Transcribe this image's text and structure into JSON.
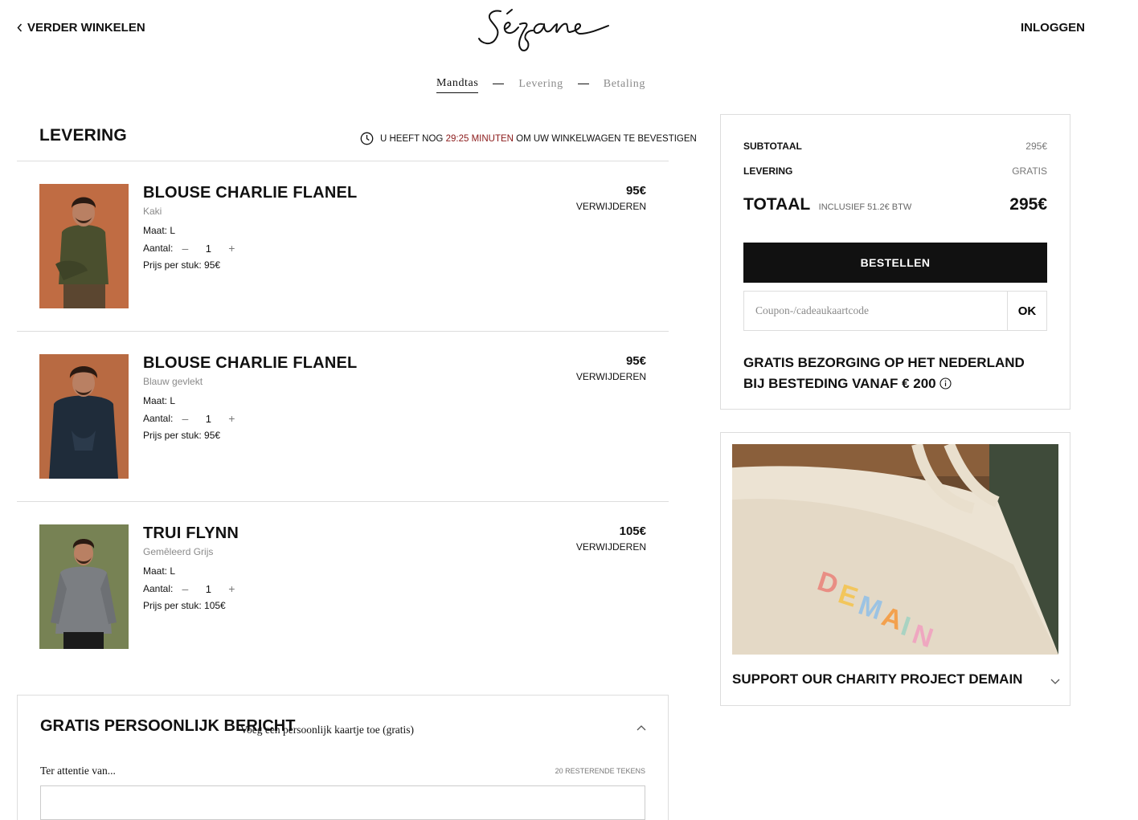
{
  "header": {
    "back_label": "VERDER WINKELEN",
    "logo_text": "Sézane",
    "login_label": "INLOGGEN"
  },
  "steps": [
    {
      "label": "Mandtas",
      "active": true
    },
    {
      "label": "Levering",
      "active": false
    },
    {
      "label": "Betaling",
      "active": false
    }
  ],
  "cart": {
    "title": "LEVERING",
    "timer_prefix": "U HEEFT NOG",
    "timer_time": "29:25 MINUTEN",
    "timer_suffix": "OM UW WINKELWAGEN TE BEVESTIGEN",
    "items": [
      {
        "name": "BLOUSE CHARLIE FLANEL",
        "variant": "Kaki",
        "size": "Maat: L",
        "qty_label": "Aantal:",
        "qty": "1",
        "unit_price": "Prijs per stuk: 95€",
        "price": "95€",
        "remove": "VERWIJDEREN"
      },
      {
        "name": "BLOUSE CHARLIE FLANEL",
        "variant": "Blauw gevlekt",
        "size": "Maat: L",
        "qty_label": "Aantal:",
        "qty": "1",
        "unit_price": "Prijs per stuk: 95€",
        "price": "95€",
        "remove": "VERWIJDEREN"
      },
      {
        "name": "TRUI FLYNN",
        "variant": "Gemêleerd Grijs",
        "size": "Maat: L",
        "qty_label": "Aantal:",
        "qty": "1",
        "unit_price": "Prijs per stuk: 105€",
        "price": "105€",
        "remove": "VERWIJDEREN"
      }
    ],
    "qty_minus": "–",
    "qty_plus": "+"
  },
  "message": {
    "title": "GRATIS PERSOONLIJK BERICHT",
    "subtitle": "Voeg een persoonlijk kaartje toe (gratis)",
    "label": "Ter attentie van...",
    "remaining": "20 RESTERENDE TEKENS",
    "value": ""
  },
  "summary": {
    "subtotal_label": "SUBTOTAAL",
    "subtotal_value": "295€",
    "delivery_label": "LEVERING",
    "delivery_value": "GRATIS",
    "total_label": "TOTAAL",
    "vat_note": "INCLUSIEF 51.2€ BTW",
    "total_value": "295€",
    "order_button": "BESTELLEN",
    "coupon_placeholder": "Coupon-/cadeaukaartcode",
    "coupon_value": "",
    "ok_button": "OK",
    "free_shipping": "GRATIS BEZORGING OP HET NEDERLAND BIJ BESTEDING VANAF € 200"
  },
  "charity": {
    "title": "SUPPORT OUR CHARITY PROJECT DEMAIN",
    "bag_text": "DEMAIN"
  },
  "colors": {
    "timer_accent": "#8b1a1a",
    "button_bg": "#111111",
    "border": "#dddddd"
  }
}
